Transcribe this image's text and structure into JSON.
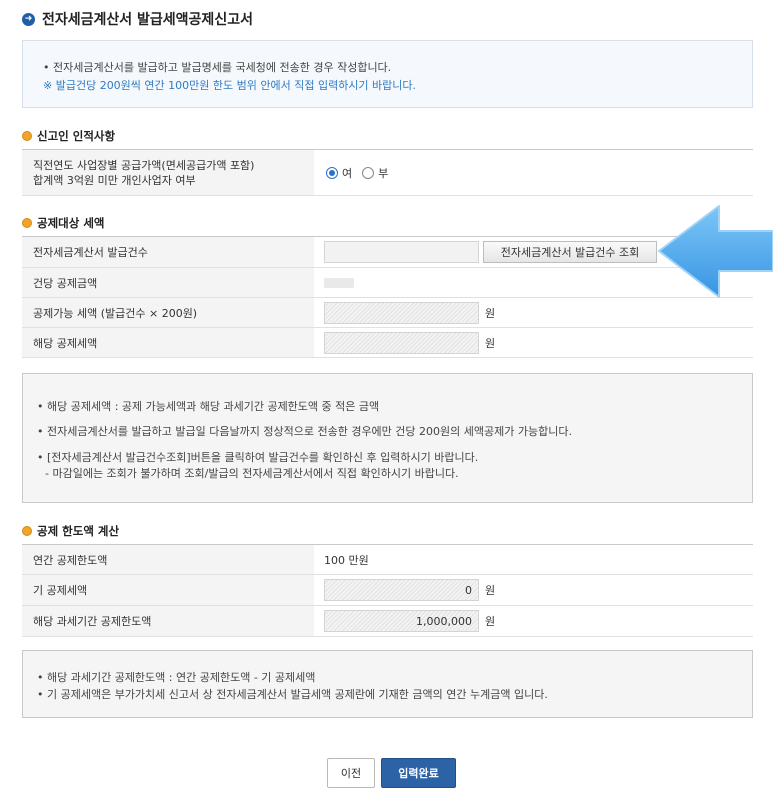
{
  "title": "전자세금계산서 발급세액공제신고서",
  "info": {
    "line1": "• 전자세금계산서를 발급하고 발급명세를 국세청에 전송한 경우 작성합니다.",
    "line2": "※ 발급건당 200원씩 연간 100만원 한도 범위 안에서 직접 입력하시기 바랍니다."
  },
  "section1": {
    "heading": "신고인 인적사항",
    "row_label_1": "직전연도 사업장별 공급가액(면세공급가액 포함)",
    "row_label_2": "합계액 3억원 미만 개인사업자 여부",
    "yes_label": "여",
    "no_label": "부",
    "selected": "여"
  },
  "section2": {
    "heading": "공제대상 세액",
    "rows": [
      {
        "label": "전자세금계산서 발급건수"
      },
      {
        "label": "건당 공제금액"
      },
      {
        "label": "공제가능 세액 (발급건수 × 200원)",
        "unit": "원"
      },
      {
        "label": "해당 공제세액",
        "unit": "원"
      }
    ],
    "lookup_button": "전자세금계산서 발급건수 조회"
  },
  "note1": {
    "line1": "• 해당 공제세액 : 공제 가능세액과 해당 과세기간 공제한도액 중 적은 금액",
    "line2": "• 전자세금계산서를 발급하고 발급일 다음날까지 정상적으로 전송한 경우에만 건당 200원의 세액공제가 가능합니다.",
    "line3": "• [전자세금계산서 발급건수조회]버튼을 클릭하여 발급건수를 확인하신 후 입력하시기 바랍니다.",
    "line4": "- 마감일에는 조회가 불가하며 조회/발급의 전자세금계산서에서 직접 확인하시기 바랍니다."
  },
  "section3": {
    "heading": "공제 한도액 계산",
    "rows": [
      {
        "label": "연간 공제한도액",
        "value": "100 만원"
      },
      {
        "label": "기 공제세액",
        "value": "0",
        "unit": "원"
      },
      {
        "label": "해당 과세기간 공제한도액",
        "value": "1,000,000",
        "unit": "원"
      }
    ]
  },
  "note2": {
    "line1": "• 해당 과세기간 공제한도액 : 연간 공제한도액 - 기 공제세액",
    "line2": "• 기 공제세액은 부가가치세 신고서 상 전자세금계산서 발급세액 공제란에 기재한 금액의 연간 누계금액 입니다."
  },
  "buttons": {
    "prev": "이전",
    "done": "입력완료"
  },
  "colors": {
    "primary": "#2c62a6",
    "title_icon": "#1f5fa8",
    "section_dot": "#f0a52a",
    "info_text": "#2f7bc3",
    "arrow": "#4aa8ee"
  }
}
